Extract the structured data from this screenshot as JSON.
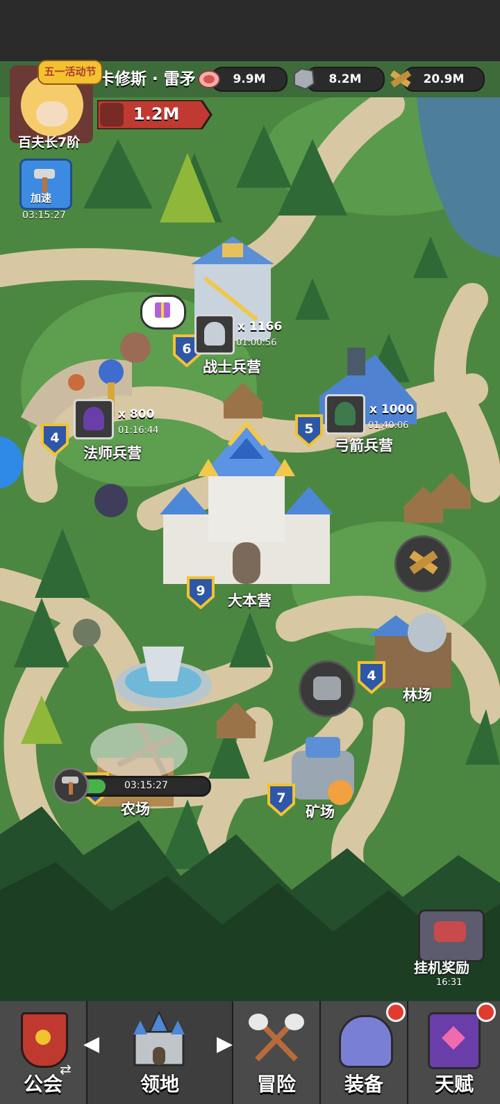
{
  "player": {
    "name": "卡修斯 · 雷矛",
    "rank": "百夫长7阶",
    "event_badge": "五一活动节",
    "power": "1.2M"
  },
  "resources": [
    {
      "name": "meat-icon",
      "value": "9.9M"
    },
    {
      "name": "stone-icon",
      "value": "8.2M"
    },
    {
      "name": "wood-icon",
      "value": "20.9M"
    }
  ],
  "speedup": {
    "label": "加速",
    "timer": "03:15:27"
  },
  "buildings": {
    "warrior": {
      "name": "战士兵营",
      "level": "6",
      "count": "x 1166",
      "timer": "01:00:56"
    },
    "mage": {
      "name": "法师兵营",
      "level": "4",
      "count": "x 800",
      "timer": "01:16:44"
    },
    "archer": {
      "name": "弓箭兵营",
      "level": "5",
      "count": "x 1000",
      "timer": "01:40:06"
    },
    "hq": {
      "name": "大本营",
      "level": "9"
    },
    "lumber": {
      "name": "林场",
      "level": "4"
    },
    "mine": {
      "name": "矿场",
      "level": "7"
    },
    "farm": {
      "name": "农场",
      "level": "4",
      "timer": "03:15:27",
      "progress": 0.22
    }
  },
  "idle_reward": {
    "label": "挂机奖励",
    "timer": "16:31"
  },
  "nav": [
    {
      "label": "公会"
    },
    {
      "label": "领地"
    },
    {
      "label": "冒险"
    },
    {
      "label": "装备"
    },
    {
      "label": "天赋"
    }
  ],
  "colors": {
    "level_badge": "#2f57a8",
    "badge_gold": "#f2c230",
    "power_banner": "#c03a32"
  }
}
